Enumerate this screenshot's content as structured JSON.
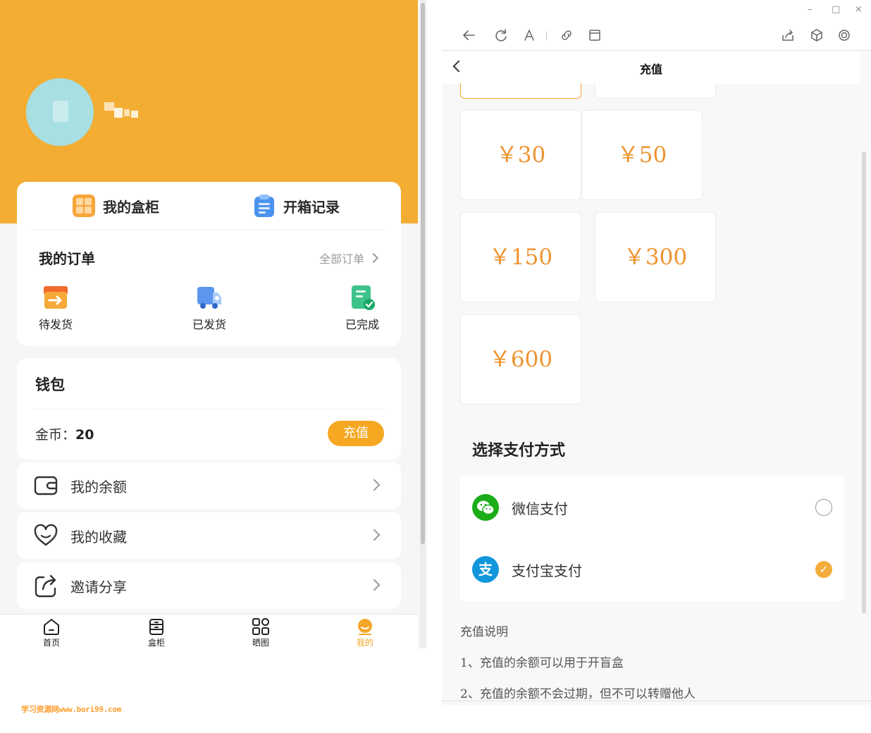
{
  "left_app": {
    "header": {
      "avatar_color": "#a7dfe3",
      "accent": "#f3ad33"
    },
    "quick_tabs": [
      {
        "label": "我的盒柜",
        "icon": "cabinet-icon"
      },
      {
        "label": "开箱记录",
        "icon": "clipboard-icon"
      }
    ],
    "orders": {
      "title": "我的订单",
      "all_label": "全部订单",
      "statuses": [
        {
          "label": "待发货",
          "icon": "box-arrow-icon"
        },
        {
          "label": "已发货",
          "icon": "truck-icon"
        },
        {
          "label": "已完成",
          "icon": "check-doc-icon"
        }
      ]
    },
    "wallet": {
      "title": "钱包",
      "coins_label": "金币：",
      "coins_value": "20",
      "recharge_label": "充值"
    },
    "menu": [
      {
        "label": "我的余额",
        "icon": "wallet-icon"
      },
      {
        "label": "我的收藏",
        "icon": "heart-icon"
      },
      {
        "label": "邀请分享",
        "icon": "share-icon"
      }
    ],
    "tabbar": [
      {
        "label": "首页",
        "icon": "home-icon"
      },
      {
        "label": "盒柜",
        "icon": "cabinet-icon"
      },
      {
        "label": "晒图",
        "icon": "grid-icon"
      },
      {
        "label": "我的",
        "icon": "profile-icon",
        "active": true
      }
    ],
    "watermark": "学习资源网www.bori99.com"
  },
  "right_app": {
    "window_buttons": [
      "–",
      "□",
      "×"
    ],
    "toolbar": [
      "back-icon",
      "refresh-icon",
      "font-icon",
      "link-icon",
      "window-icon",
      "export-icon",
      "cube-icon",
      "settings-icon"
    ],
    "page_title": "充值",
    "amounts": [
      "￥30",
      "￥50",
      "￥150",
      "￥300",
      "￥600"
    ],
    "payment": {
      "title": "选择支付方式",
      "options": [
        {
          "label": "微信支付",
          "selected": false,
          "color": "#1aad19",
          "logo": "wechat-icon"
        },
        {
          "label": "支付宝支付",
          "selected": true,
          "color": "#1296db",
          "logo": "alipay-icon"
        }
      ],
      "check_glyph": "✓",
      "alipay_glyph": "支"
    },
    "notes": {
      "title": "充值说明",
      "items": [
        "1、充值的余额可以用于开盲盒",
        "2、充值的余额不会过期，但不可以转赠他人"
      ]
    }
  }
}
